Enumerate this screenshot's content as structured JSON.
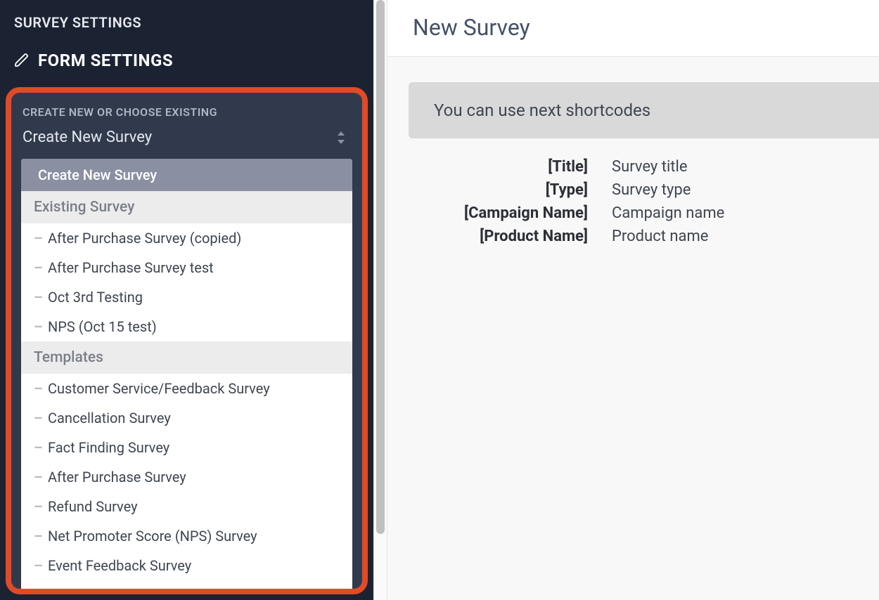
{
  "sidebar": {
    "title": "SURVEY SETTINGS",
    "section_title": "FORM SETTINGS",
    "dropdown_label": "CREATE NEW OR CHOOSE EXISTING",
    "selected_value": "Create New Survey",
    "selected_option": "Create New Survey",
    "group_existing_label": "Existing Survey",
    "group_templates_label": "Templates",
    "existing": [
      {
        "bullet": "–",
        "label": "After Purchase Survey (copied)"
      },
      {
        "bullet": "–",
        "label": "After Purchase Survey test"
      },
      {
        "bullet": "–",
        "label": "Oct 3rd Testing"
      },
      {
        "bullet": "–",
        "label": "NPS (Oct 15 test)"
      }
    ],
    "templates": [
      {
        "bullet": "–",
        "label": "Customer Service/Feedback Survey"
      },
      {
        "bullet": "–",
        "label": "Cancellation Survey"
      },
      {
        "bullet": "–",
        "label": "Fact Finding Survey"
      },
      {
        "bullet": "–",
        "label": "After Purchase Survey"
      },
      {
        "bullet": "–",
        "label": "Refund Survey"
      },
      {
        "bullet": "–",
        "label": "Net Promoter Score (NPS) Survey"
      },
      {
        "bullet": "–",
        "label": "Event Feedback Survey"
      }
    ]
  },
  "main": {
    "title": "New Survey",
    "shortcodes_heading": "You can use next shortcodes",
    "shortcodes": [
      {
        "code": "[Title]",
        "desc": "Survey title"
      },
      {
        "code": "[Type]",
        "desc": "Survey type"
      },
      {
        "code": "[Campaign Name]",
        "desc": "Campaign name"
      },
      {
        "code": "[Product Name]",
        "desc": "Product name"
      }
    ]
  }
}
